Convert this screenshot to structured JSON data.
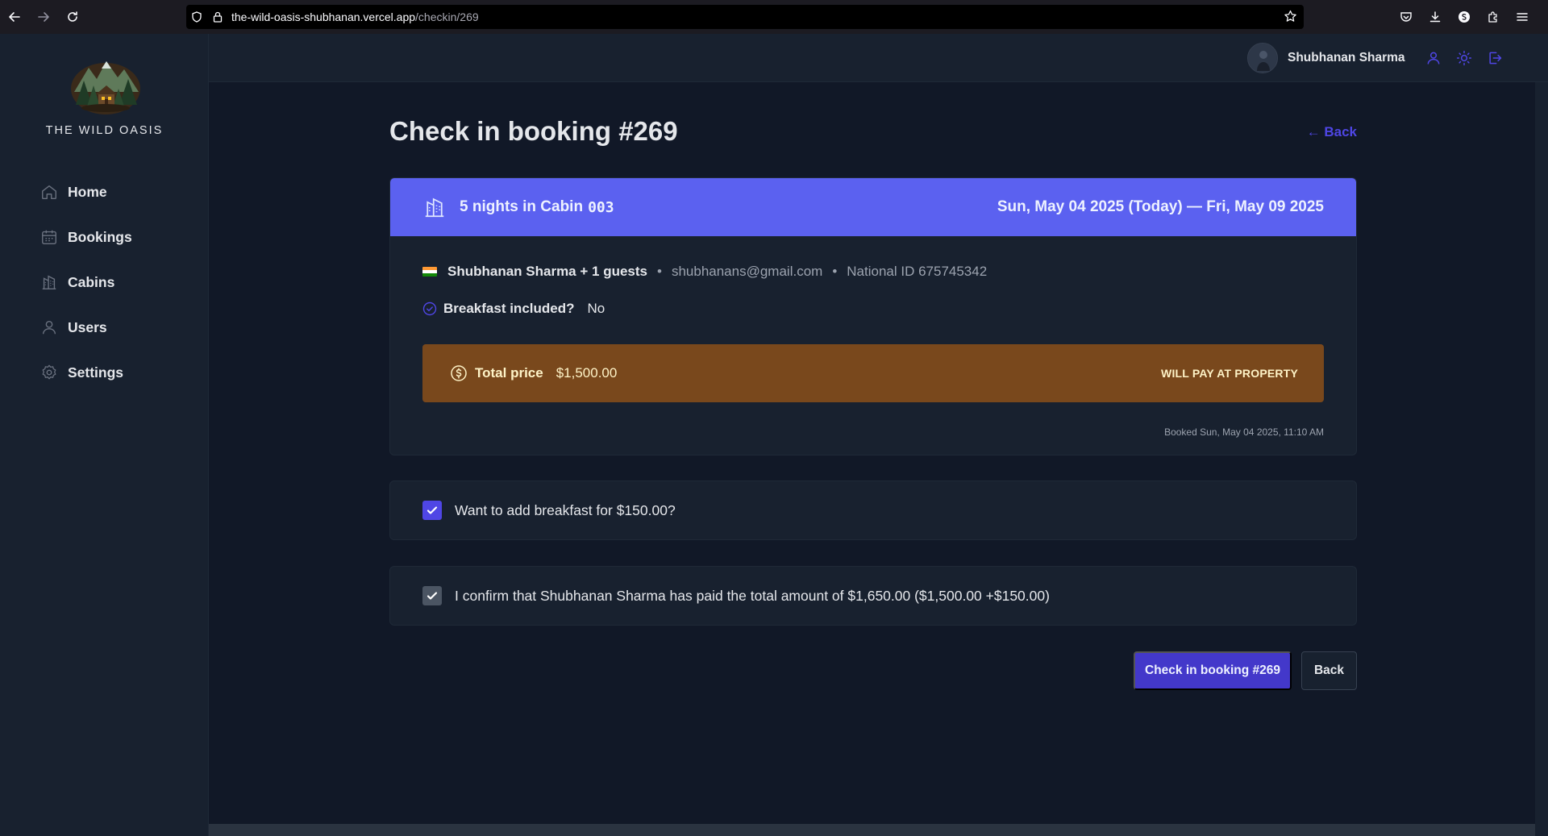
{
  "browser": {
    "url_host": "the-wild-oasis-shubhanan.vercel.app",
    "url_path": "/checkin/269"
  },
  "sidebar": {
    "brand": "THE WILD OASIS",
    "items": [
      {
        "label": "Home",
        "icon": "home-icon"
      },
      {
        "label": "Bookings",
        "icon": "calendar-icon"
      },
      {
        "label": "Cabins",
        "icon": "building-icon"
      },
      {
        "label": "Users",
        "icon": "user-icon"
      },
      {
        "label": "Settings",
        "icon": "gear-icon"
      }
    ]
  },
  "header": {
    "user_name": "Shubhanan Sharma"
  },
  "page": {
    "title": "Check in booking #269",
    "back_link": "← Back"
  },
  "booking": {
    "nights_text": "5 nights in Cabin",
    "cabin": "003",
    "dates": "Sun, May 04 2025 (Today) — Fri, May 09 2025",
    "guest": "Shubhanan Sharma + 1 guests",
    "email": "shubhanans@gmail.com",
    "national_id": "National ID 675745342",
    "breakfast_label": "Breakfast included?",
    "breakfast_value": "No",
    "price_label": "Total price",
    "price_value": "$1,500.00",
    "pay_status": "WILL PAY AT PROPERTY",
    "booked_at": "Booked Sun, May 04 2025, 11:10 AM"
  },
  "options": {
    "add_breakfast": "Want to add breakfast for $150.00?",
    "confirm_paid": "I confirm that Shubhanan Sharma has paid the total amount of $1,650.00 ($1,500.00 +$150.00)"
  },
  "actions": {
    "checkin": "Check in booking #269",
    "back": "Back"
  },
  "colors": {
    "accent": "#4f46e5",
    "card_header": "#5b61f0",
    "price_box": "#79481c"
  }
}
